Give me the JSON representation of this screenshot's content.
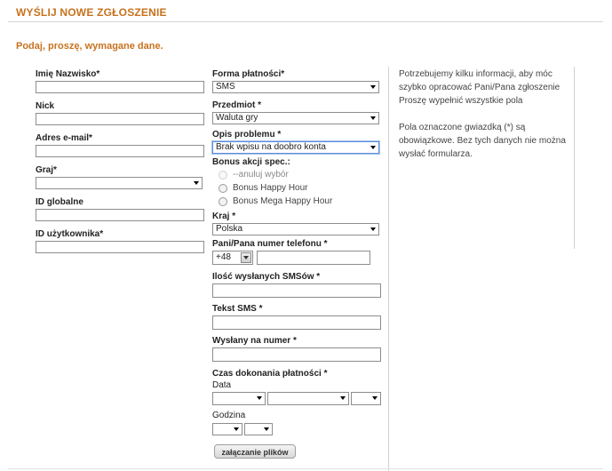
{
  "header": {
    "title": "WYŚLIJ NOWE ZGŁOSZENIE"
  },
  "subtitle": "Podaj, proszę, wymagane dane.",
  "left_form": {
    "name_label": "Imię Nazwisko*",
    "nick_label": "Nick",
    "email_label": "Adres e-mail*",
    "game_label": "Graj*",
    "global_id_label": "ID globalne",
    "user_id_label": "ID użytkownika*"
  },
  "right_form": {
    "payment_label": "Forma płatności*",
    "payment_value": "SMS",
    "subject_label": "Przedmiot *",
    "subject_value": "Waluta gry",
    "problem_label": "Opis problemu *",
    "problem_value": "Brak wpisu na doobro konta",
    "bonus_label": "Bonus akcji spec.:",
    "bonus_options": [
      "--anuluj wybór",
      "Bonus Happy Hour",
      "Bonus Mega Happy Hour"
    ],
    "country_label": "Kraj *",
    "country_value": "Polska",
    "phone_label": "Pani/Pana numer telefonu *",
    "phone_prefix": "+48",
    "sms_count_label": "Ilość wysłanych SMSów *",
    "sms_text_label": "Tekst SMS *",
    "sent_to_label": "Wysłany na numer *",
    "payment_time_label": "Czas dokonania płatności *",
    "date_label": "Data",
    "hour_label": "Godzina",
    "attach_button": "załączanie plików"
  },
  "info": {
    "p1": "Potrzebujemy kilku informacji, aby móc szybko opracować Pani/Pana zgłoszenie Proszę wypełnić wszystkie pola",
    "p2": "Pola oznaczone gwiazdką (*) są obowiązkowe. Bez tych danych nie można wysłać formularza."
  },
  "colors": {
    "accent": "#c8721e",
    "border": "#8d8d8d",
    "focus": "#5b8fd8"
  }
}
